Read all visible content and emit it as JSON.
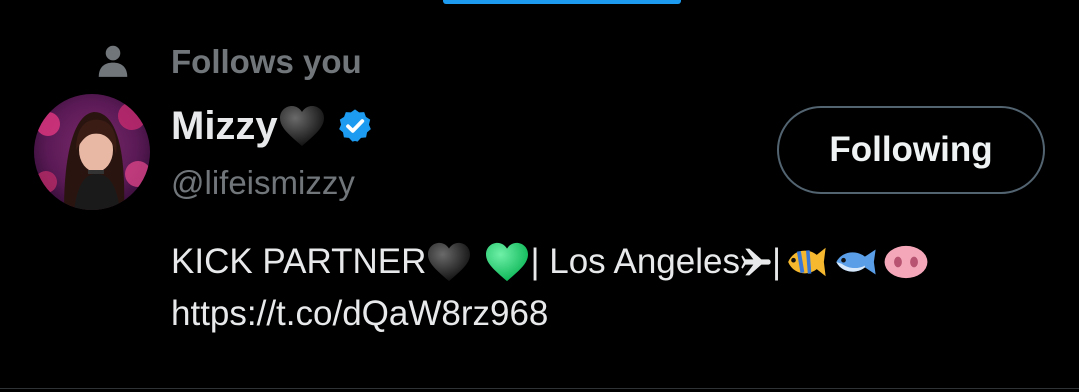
{
  "follows_label": "Follows you",
  "profile": {
    "display_name": "Mizzy",
    "name_emoji": "black-heart",
    "verified": true,
    "handle": "@lifeismizzy"
  },
  "follow_button": {
    "label": "Following"
  },
  "bio": {
    "segments": [
      {
        "type": "text",
        "text": "KICK PARTNER"
      },
      {
        "type": "emoji",
        "name": "black-heart"
      },
      {
        "type": "emoji",
        "name": "green-heart"
      },
      {
        "type": "text",
        "text": "| Los Angeles "
      },
      {
        "type": "emoji",
        "name": "airplane"
      },
      {
        "type": "text",
        "text": "| "
      },
      {
        "type": "emoji",
        "name": "tropical-fish"
      },
      {
        "type": "emoji",
        "name": "fish"
      },
      {
        "type": "emoji",
        "name": "pig-nose"
      }
    ],
    "bio_text_1": "KICK PARTNER",
    "bio_text_2": "| Los Angeles ",
    "bio_text_3": "| ",
    "link": "https://t.co/dQaW8rz968"
  },
  "colors": {
    "background": "#000000",
    "primary_text": "#e7e9ea",
    "secondary_text": "#71767b",
    "accent": "#1d9bf0",
    "button_border": "#536471"
  }
}
